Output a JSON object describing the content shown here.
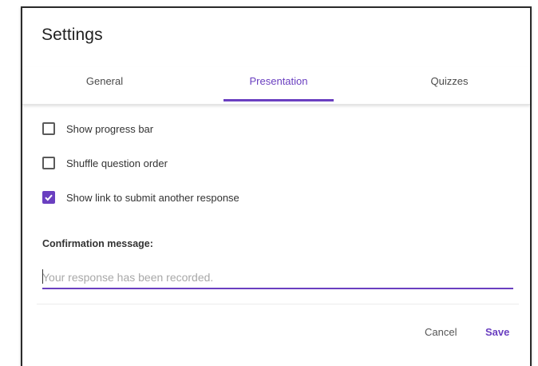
{
  "dialog": {
    "title": "Settings"
  },
  "tabs": [
    {
      "label": "General",
      "active": false
    },
    {
      "label": "Presentation",
      "active": true
    },
    {
      "label": "Quizzes",
      "active": false
    }
  ],
  "options": [
    {
      "label": "Show progress bar",
      "checked": false
    },
    {
      "label": "Shuffle question order",
      "checked": false
    },
    {
      "label": "Show link to submit another response",
      "checked": true
    }
  ],
  "confirmation": {
    "label": "Confirmation message:",
    "value": "",
    "placeholder": "Your response has been recorded."
  },
  "actions": {
    "cancel_label": "Cancel",
    "save_label": "Save"
  },
  "colors": {
    "accent": "#6a3fc0",
    "text": "#333333",
    "placeholder": "#a8a8a8"
  }
}
